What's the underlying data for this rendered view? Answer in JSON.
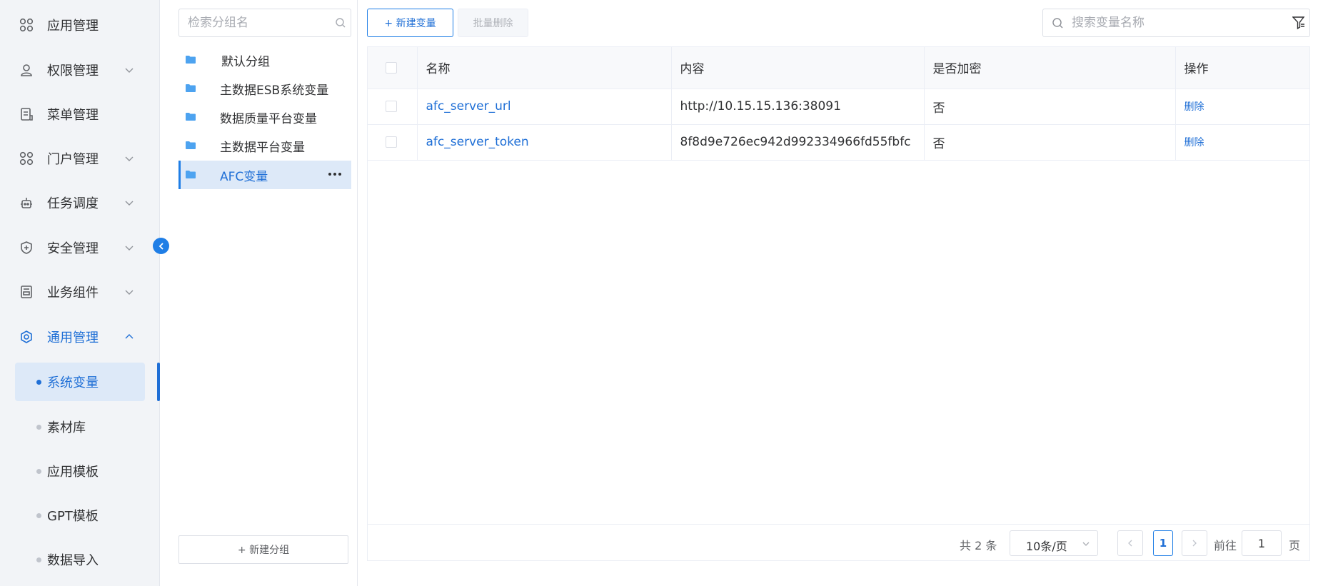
{
  "sidebar": {
    "menu": [
      {
        "label": "应用管理",
        "icon": "apps-icon",
        "arrow": ""
      },
      {
        "label": "权限管理",
        "icon": "user-icon",
        "arrow": "down"
      },
      {
        "label": "菜单管理",
        "icon": "document-icon",
        "arrow": ""
      },
      {
        "label": "门户管理",
        "icon": "apps-icon",
        "arrow": "down"
      },
      {
        "label": "任务调度",
        "icon": "robot-icon",
        "arrow": "down"
      },
      {
        "label": "安全管理",
        "icon": "shield-icon",
        "arrow": "down"
      },
      {
        "label": "业务组件",
        "icon": "component-icon",
        "arrow": "down"
      },
      {
        "label": "通用管理",
        "icon": "gear-icon",
        "arrow": "up"
      }
    ],
    "sub_items": [
      {
        "label": "系统变量",
        "active": true
      },
      {
        "label": "素材库"
      },
      {
        "label": "应用模板"
      },
      {
        "label": "GPT模板"
      },
      {
        "label": "数据导入"
      }
    ]
  },
  "groups": {
    "search_placeholder": "检索分组名",
    "items": [
      {
        "label": "默认分组"
      },
      {
        "label": "主数据ESB系统变量"
      },
      {
        "label": "数据质量平台变量"
      },
      {
        "label": "主数据平台变量"
      },
      {
        "label": "AFC变量",
        "active": true
      }
    ],
    "new_group_label": "+ 新建分组"
  },
  "toolbar": {
    "new_variable_label": "+ 新建变量",
    "batch_delete_label": "批量删除",
    "search_placeholder": "搜索变量名称"
  },
  "table": {
    "columns": [
      "名称",
      "内容",
      "是否加密",
      "操作"
    ],
    "rows": [
      {
        "name": "afc_server_url",
        "content": "http://10.15.15.136:38091",
        "encrypted": "否",
        "action": "删除"
      },
      {
        "name": "afc_server_token",
        "content": "8f8d9e726ec942d992334966fd55fbfc",
        "encrypted": "否",
        "action": "删除"
      }
    ]
  },
  "pagination": {
    "total_text": "共 2 条",
    "page_size": "10条/页",
    "current_page": "1",
    "goto_label": "前往",
    "goto_value": "1",
    "page_suffix": "页"
  },
  "colors": {
    "accent": "#1f6fd6",
    "sidebar_bg": "#f2f4f7",
    "active_bg": "#dde9f8"
  }
}
